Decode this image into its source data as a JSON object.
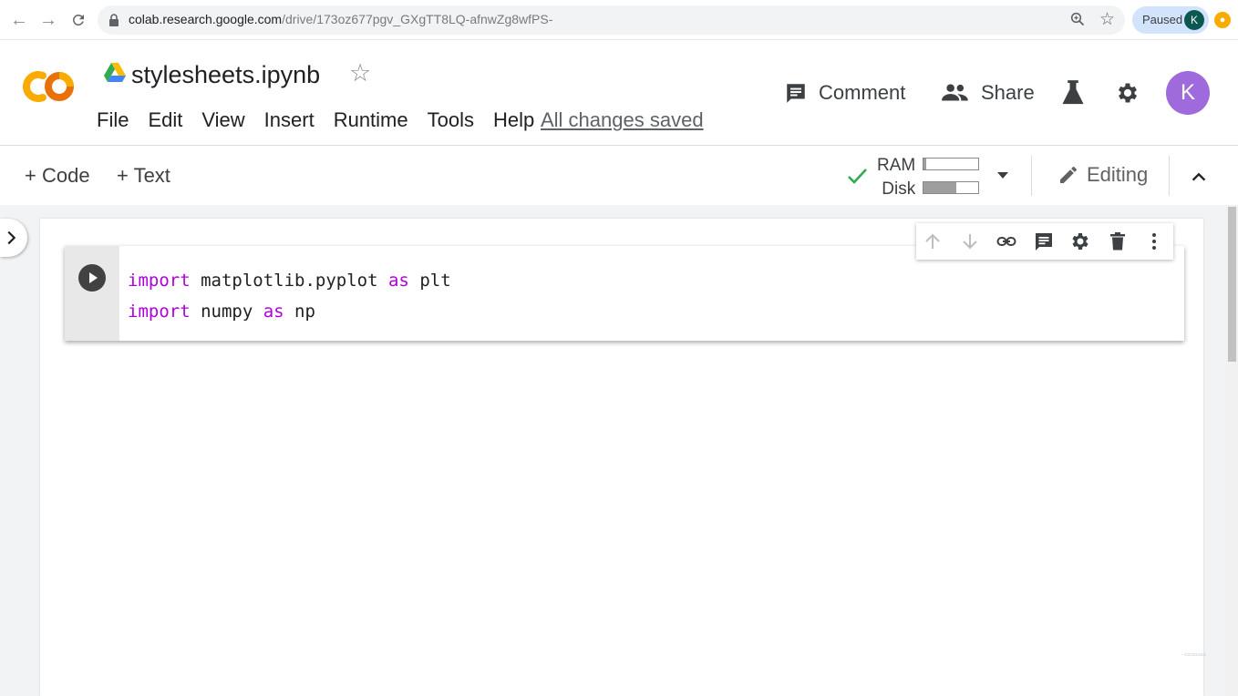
{
  "browser": {
    "url_host": "colab.research.google.com",
    "url_path": "/drive/173oz677pgv_GXgTT8LQ-afnwZg8wfPS-",
    "profile_status": "Paused",
    "profile_initial": "K"
  },
  "header": {
    "logo_text": "CO",
    "notebook_title": "stylesheets.ipynb",
    "menu": [
      "File",
      "Edit",
      "View",
      "Insert",
      "Runtime",
      "Tools",
      "Help"
    ],
    "save_status": "All changes saved",
    "comment_label": "Comment",
    "share_label": "Share",
    "avatar_initial": "K",
    "avatar_color": "#9e6adc"
  },
  "toolbar": {
    "add_code_label": "+ Code",
    "add_text_label": "+ Text",
    "ram_label": "RAM",
    "disk_label": "Disk",
    "ram_usage_fraction": 0.05,
    "disk_usage_fraction": 0.6,
    "mode_label": "Editing",
    "connected_color": "#34a853"
  },
  "cell": {
    "lines": [
      [
        {
          "t": "import",
          "kw": true
        },
        {
          "t": " matplotlib.pyplot ",
          "kw": false
        },
        {
          "t": "as",
          "kw": true
        },
        {
          "t": " plt",
          "kw": false
        }
      ],
      [
        {
          "t": "import",
          "kw": true
        },
        {
          "t": " numpy ",
          "kw": false
        },
        {
          "t": "as",
          "kw": true
        },
        {
          "t": " np",
          "kw": false
        }
      ]
    ],
    "keyword_color": "#af00db"
  }
}
